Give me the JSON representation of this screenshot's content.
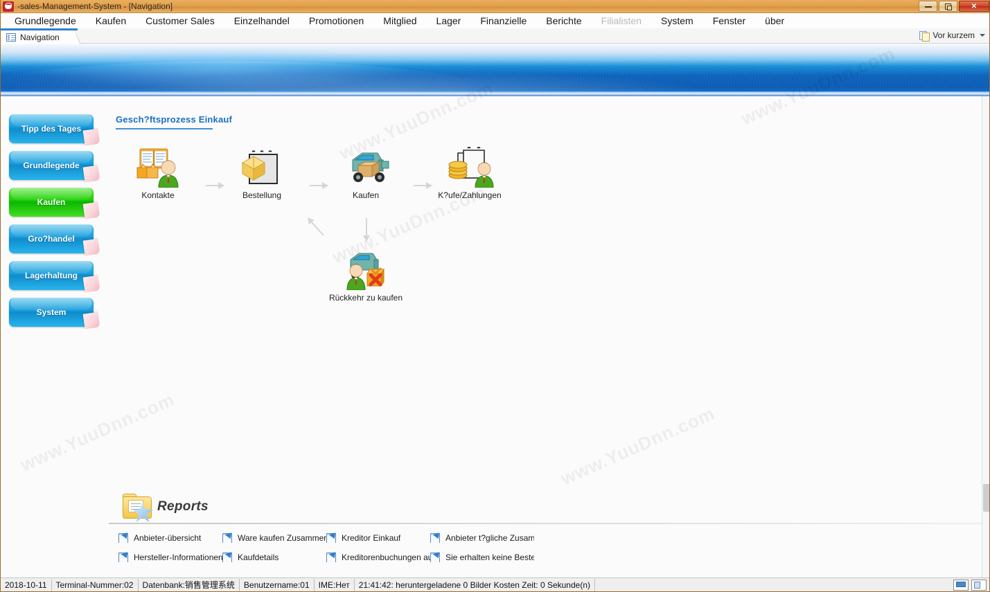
{
  "window": {
    "title": "-sales-Management-System - [Navigation]",
    "app_icon": "shopping-cart-icon",
    "buttons": {
      "minimize": "minimize-icon",
      "restore": "restore-icon",
      "close": "close-icon"
    }
  },
  "menubar": {
    "items": [
      {
        "label": "Grundlegende",
        "disabled": false
      },
      {
        "label": "Kaufen",
        "disabled": false
      },
      {
        "label": "Customer Sales",
        "disabled": false
      },
      {
        "label": "Einzelhandel",
        "disabled": false
      },
      {
        "label": "Promotionen",
        "disabled": false
      },
      {
        "label": "Mitglied",
        "disabled": false
      },
      {
        "label": "Lager",
        "disabled": false
      },
      {
        "label": "Finanzielle",
        "disabled": false
      },
      {
        "label": "Berichte",
        "disabled": false
      },
      {
        "label": "Filialisten",
        "disabled": true
      },
      {
        "label": "System",
        "disabled": false
      },
      {
        "label": "Fenster",
        "disabled": false
      },
      {
        "label": "über",
        "disabled": false
      }
    ]
  },
  "tabstrip": {
    "active_tab": "Navigation",
    "tab_icon": "form-list-icon",
    "recent": {
      "label": "Vor kurzem",
      "icon": "copy-pages-icon",
      "caret": "chevron-down-icon"
    }
  },
  "sidebar": {
    "items": [
      {
        "label": "Tipp des Tages",
        "active": false
      },
      {
        "label": "Grundlegende",
        "active": false
      },
      {
        "label": "Kaufen",
        "active": true
      },
      {
        "label": "Gro?handel",
        "active": false
      },
      {
        "label": "Lagerhaltung",
        "active": false
      },
      {
        "label": "System",
        "active": false
      }
    ],
    "accent_blue": "#1c9fdd",
    "accent_green": "#1fcf06"
  },
  "process": {
    "title": "Gesch?ftsprozess Einkauf",
    "title_color": "#1a6fc4",
    "nodes": [
      {
        "label": "Kontakte",
        "icon": "contacts-book-person-icon"
      },
      {
        "label": "Bestellung",
        "icon": "order-clipboard-box-icon"
      },
      {
        "label": "Kaufen",
        "icon": "delivery-truck-icon"
      },
      {
        "label": "K?ufe/Zahlungen",
        "icon": "payments-coins-clipboard-icon"
      },
      {
        "label": "Rückkehr zu kaufen",
        "icon": "return-purchase-truck-icon"
      }
    ]
  },
  "reports": {
    "title": "Reports",
    "icon": "folder-star-icon",
    "items": [
      {
        "label": "Anbieter-übersicht",
        "icon": "report-note-icon"
      },
      {
        "label": "Ware kaufen Zusammenfa",
        "icon": "report-note-icon"
      },
      {
        "label": "Kreditor Einkauf",
        "icon": "report-note-icon"
      },
      {
        "label": "Anbieter t?gliche Zusamme",
        "icon": "report-note-icon"
      },
      {
        "label": "Hersteller-Informationen",
        "icon": "report-note-icon"
      },
      {
        "label": "Kaufdetails",
        "icon": "report-note-icon"
      },
      {
        "label": "Kreditorenbuchungen auf",
        "icon": "report-note-icon"
      },
      {
        "label": "Sie erhalten keine Bestellu",
        "icon": "report-note-icon"
      }
    ]
  },
  "statusbar": {
    "cells": [
      "2018-10-11",
      "Terminal-Nummer:02",
      "Datenbank:销售管理系统",
      "Benutzername:01",
      "IME:Нет",
      "21:41:42: heruntergeladene 0 Bilder Kosten Zeit: 0 Sekunde(n)"
    ],
    "icons": [
      "window-layout-horizontal-icon",
      "window-layout-vertical-icon"
    ]
  },
  "watermarks": [
    "www.YuuDnn.com",
    "www.YuuDnn.com",
    "www.YuuDnn.com",
    "www.YuuDnn.com",
    "www.YuuDnn.com"
  ]
}
